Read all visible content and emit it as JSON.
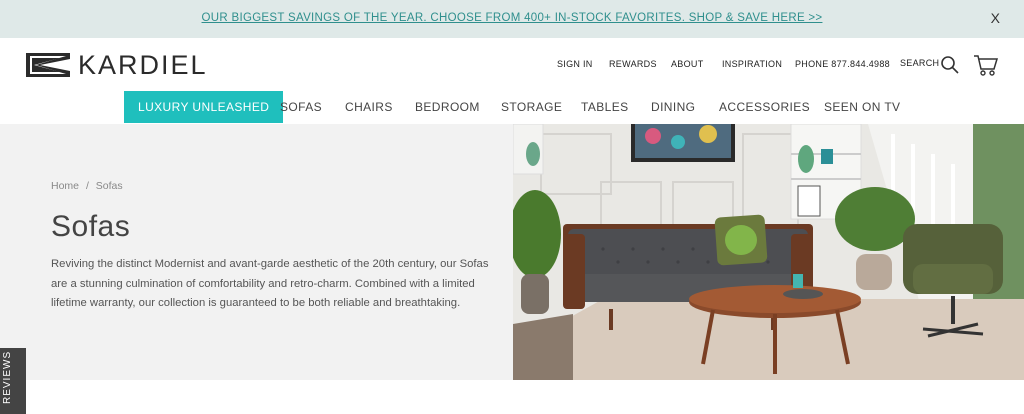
{
  "promo": {
    "text": "OUR BIGGEST SAVINGS OF THE YEAR. CHOOSE FROM 400+ IN-STOCK FAVORITES. SHOP & SAVE HERE >>",
    "close": "X"
  },
  "brand": {
    "name": "KARDIEL"
  },
  "utility_nav": {
    "sign_in": "SIGN IN",
    "rewards": "REWARDS",
    "about": "ABOUT",
    "inspiration": "INSPIRATION",
    "phone": "PHONE 877.844.4988",
    "search": "SEARCH"
  },
  "main_nav": [
    {
      "label": "LUXURY UNLEASHED"
    },
    {
      "label": "SOFAS"
    },
    {
      "label": "CHAIRS"
    },
    {
      "label": "BEDROOM"
    },
    {
      "label": "STORAGE"
    },
    {
      "label": "TABLES"
    },
    {
      "label": "DINING"
    },
    {
      "label": "ACCESSORIES"
    },
    {
      "label": "SEEN ON TV"
    }
  ],
  "breadcrumb": {
    "home": "Home",
    "separator": "/",
    "current": "Sofas"
  },
  "hero": {
    "title": "Sofas",
    "description": "Reviving the distinct Modernist and avant-garde aesthetic of the 20th century, our Sofas are a stunning culmination of comfortability and retro-charm. Combined with a limited lifetime warranty, our collection is guaranteed to be both reliable and breathtaking."
  },
  "reviews_tab": {
    "label": "REVIEWS"
  },
  "colors": {
    "accent": "#1fbfbd",
    "promo_bg": "#dfe9e8",
    "promo_text": "#2f8f8d",
    "hero_bg": "#f2f2f2"
  },
  "icons": [
    "logo-chevron-icon",
    "search-icon",
    "cart-icon",
    "star-icon"
  ]
}
